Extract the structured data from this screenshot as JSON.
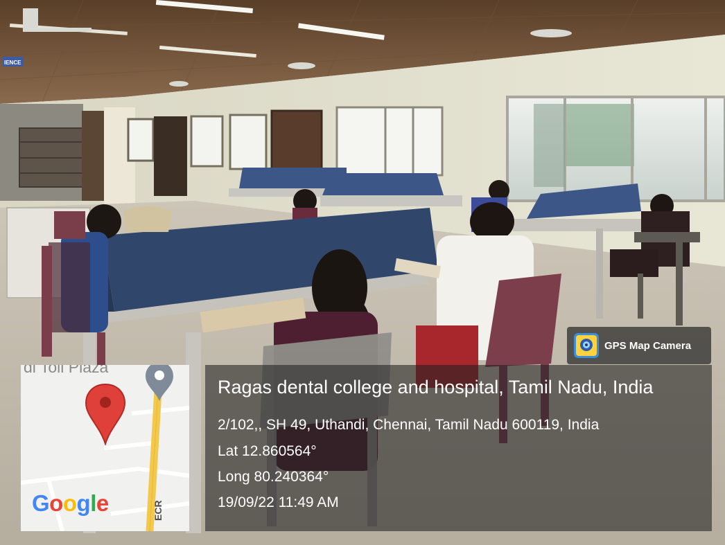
{
  "gps_badge": {
    "label": "GPS Map Camera",
    "icon": "gps-map-camera-icon"
  },
  "map": {
    "place_label": "di Toll Plaza",
    "road_label": "ECR",
    "logo_text": [
      "G",
      "o",
      "o",
      "g",
      "l",
      "e"
    ],
    "logo_colors": [
      "#4285F4",
      "#EA4335",
      "#FBBC05",
      "#4285F4",
      "#34A853",
      "#EA4335"
    ],
    "pin_icon": "map-pin-icon",
    "pin_color": "#e0403a",
    "secondary_pin_icon": "map-marker-icon"
  },
  "location": {
    "title": "Ragas dental college and hospital, Tamil Nadu, India",
    "address": "2/102,, SH 49, Uthandi, Chennai, Tamil Nadu 600119, India",
    "latitude": "Lat 12.860564°",
    "longitude": "Long 80.240364°",
    "timestamp": "19/09/22 11:49 AM"
  },
  "scene": {
    "sign_text": "IENCE"
  }
}
